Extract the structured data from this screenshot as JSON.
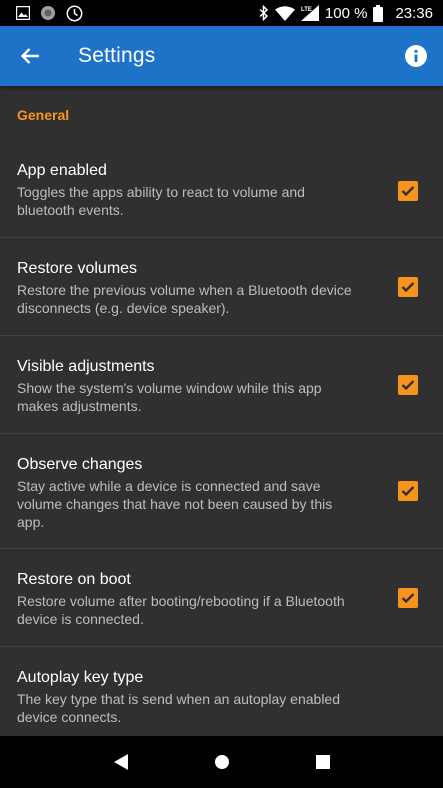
{
  "status_bar": {
    "icons_left": [
      "image-icon",
      "record-icon",
      "clock-icon"
    ],
    "icons_right": [
      "bluetooth-icon",
      "wifi-icon",
      "lte-signal-icon",
      "battery-icon"
    ],
    "battery": "100 %",
    "time": "23:36"
  },
  "app_bar": {
    "title": "Settings",
    "color": "#1e73c9"
  },
  "accent_color": "#f7941d",
  "category": "General",
  "prefs": [
    {
      "title": "App enabled",
      "summary": "Toggles the apps ability to react to volume and bluetooth events.",
      "checked": true
    },
    {
      "title": "Restore volumes",
      "summary": "Restore the previous volume when a Bluetooth device disconnects (e.g. device speaker).",
      "checked": true
    },
    {
      "title": "Visible adjustments",
      "summary": "Show the system's volume window while this app makes adjustments.",
      "checked": true
    },
    {
      "title": "Observe changes",
      "summary": "Stay active while a device is connected and save volume changes that have not been caused by this app.",
      "checked": true
    },
    {
      "title": "Restore on boot",
      "summary": "Restore volume after booting/rebooting if a Bluetooth device is connected.",
      "checked": true
    },
    {
      "title": "Autoplay key type",
      "summary": "The key type that is send when an autoplay enabled device connects."
    }
  ],
  "nav_bar": [
    "back-icon",
    "home-icon",
    "recents-icon"
  ]
}
